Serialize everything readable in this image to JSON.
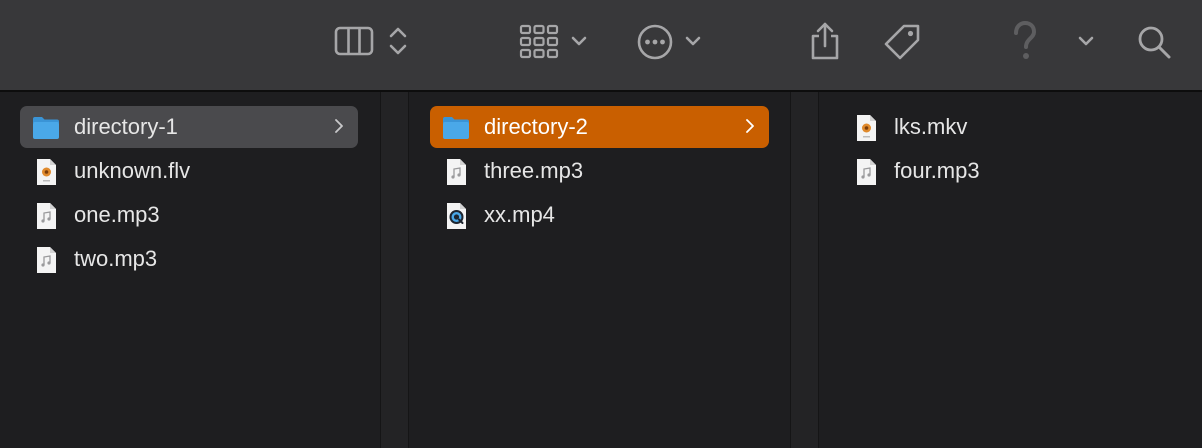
{
  "toolbar": {
    "view_columns_icon": "columns-view-icon",
    "view_updown_icon": "chevron-updown-icon",
    "group_icon": "grid-group-icon",
    "group_menu_icon": "chevron-down-icon",
    "action_icon": "ellipsis-circle-icon",
    "action_menu_icon": "chevron-down-icon",
    "share_icon": "share-icon",
    "tag_icon": "tag-icon",
    "help_icon": "question-mark-icon",
    "more_menu_icon": "chevron-down-icon",
    "search_icon": "search-icon"
  },
  "columns": [
    {
      "items": [
        {
          "name": "directory-1",
          "type": "folder",
          "selected": "inactive",
          "has_children": true
        },
        {
          "name": "unknown.flv",
          "type": "video-doc"
        },
        {
          "name": "one.mp3",
          "type": "audio"
        },
        {
          "name": "two.mp3",
          "type": "audio"
        }
      ]
    },
    {
      "items": [
        {
          "name": "directory-2",
          "type": "folder",
          "selected": "active",
          "has_children": true
        },
        {
          "name": "three.mp3",
          "type": "audio"
        },
        {
          "name": "xx.mp4",
          "type": "quicktime"
        }
      ]
    },
    {
      "items": [
        {
          "name": "lks.mkv",
          "type": "video-doc"
        },
        {
          "name": "four.mp3",
          "type": "audio"
        }
      ]
    }
  ],
  "colors": {
    "toolbar_bg": "#38383a",
    "content_bg": "#1e1e20",
    "selection_active": "#c95f00",
    "selection_inactive": "#4a4a4d",
    "folder_blue": "#4aa8e8",
    "icon_gray": "#9a9a9c"
  }
}
